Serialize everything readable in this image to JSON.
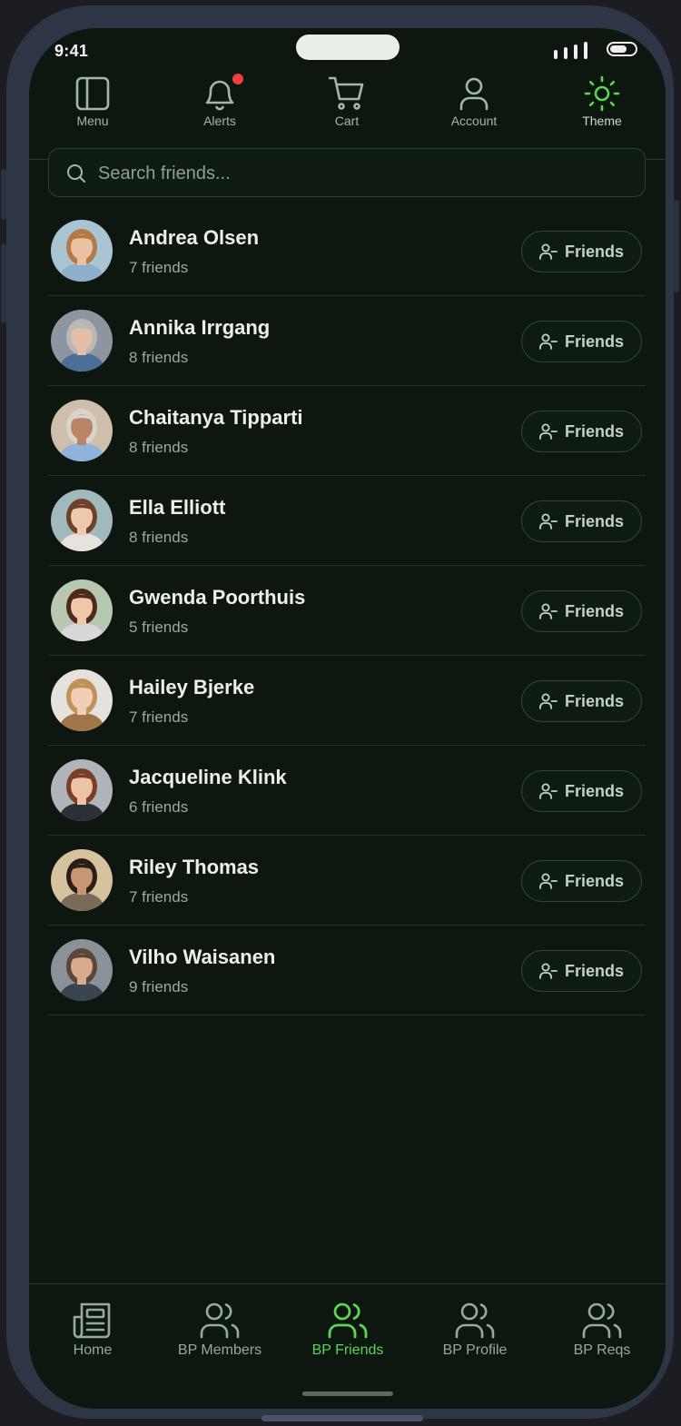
{
  "status_bar": {
    "time": "9:41"
  },
  "top_nav": [
    {
      "label": "Menu",
      "icon": "sidebar-panel-icon",
      "active": false
    },
    {
      "label": "Alerts",
      "icon": "bell-icon",
      "active": false,
      "has_badge": true,
      "badge_color": "#ef4040"
    },
    {
      "label": "Cart",
      "icon": "cart-icon",
      "active": false
    },
    {
      "label": "Account",
      "icon": "user-icon",
      "active": false
    },
    {
      "label": "Theme",
      "icon": "sun-icon",
      "active": true
    }
  ],
  "search": {
    "placeholder": "Search friends...",
    "value": ""
  },
  "friends": [
    {
      "name": "Andrea Olsen",
      "count": "7 friends",
      "button": "Friends",
      "avatar": {
        "skin": "#e8c2a2",
        "hair": "#b27a45",
        "shirt": "#8fb0cc",
        "bg": "#a9c4d3"
      }
    },
    {
      "name": "Annika Irrgang",
      "count": "8 friends",
      "button": "Friends",
      "avatar": {
        "skin": "#e2bfa6",
        "hair": "#b8b8b8",
        "shirt": "#4a6f98",
        "bg": "#8d96a0"
      }
    },
    {
      "name": "Chaitanya Tipparti",
      "count": "8 friends",
      "button": "Friends",
      "avatar": {
        "skin": "#b98566",
        "hair": "#d9d3cc",
        "shirt": "#8eb4d9",
        "bg": "#cdbfa9"
      }
    },
    {
      "name": "Ella Elliott",
      "count": "8 friends",
      "button": "Friends",
      "avatar": {
        "skin": "#efc9ad",
        "hair": "#6e4128",
        "shirt": "#e8e2dc",
        "bg": "#9fb9bd"
      }
    },
    {
      "name": "Gwenda Poorthuis",
      "count": "5 friends",
      "button": "Friends",
      "avatar": {
        "skin": "#efc8ab",
        "hair": "#4e2a1c",
        "shirt": "#d8d8d8",
        "bg": "#b8c7b0"
      }
    },
    {
      "name": "Hailey Bjerke",
      "count": "7 friends",
      "button": "Friends",
      "avatar": {
        "skin": "#efcfb5",
        "hair": "#c09159",
        "shirt": "#a07648",
        "bg": "#e4e2dd"
      }
    },
    {
      "name": "Jacqueline Klink",
      "count": "6 friends",
      "button": "Friends",
      "avatar": {
        "skin": "#ecc3a5",
        "hair": "#7a3e26",
        "shirt": "#2b2f36",
        "bg": "#aeb4b8"
      }
    },
    {
      "name": "Riley Thomas",
      "count": "7 friends",
      "button": "Friends",
      "avatar": {
        "skin": "#c99673",
        "hair": "#2a1f18",
        "shirt": "#7a6b58",
        "bg": "#d6c39e"
      }
    },
    {
      "name": "Vilho Waisanen",
      "count": "9 friends",
      "button": "Friends",
      "avatar": {
        "skin": "#d9ab8e",
        "hair": "#5c4636",
        "shirt": "#3b4550",
        "bg": "#8a9198"
      }
    }
  ],
  "bottom_nav": [
    {
      "label": "Home",
      "icon": "newspaper-icon",
      "active": false
    },
    {
      "label": "BP Members",
      "icon": "users-icon",
      "active": false
    },
    {
      "label": "BP Friends",
      "icon": "users-icon",
      "active": true
    },
    {
      "label": "BP Profile",
      "icon": "users-icon",
      "active": false
    },
    {
      "label": "BP Reqs",
      "icon": "users-icon",
      "active": false
    }
  ],
  "colors": {
    "accent": "#5ed358",
    "background": "#0d170f",
    "frame": "#2e3544"
  }
}
